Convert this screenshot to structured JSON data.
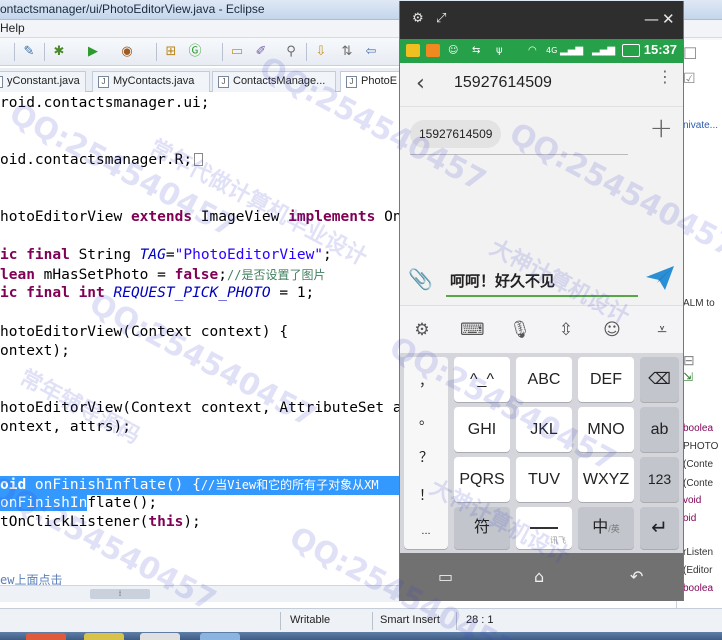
{
  "window": {
    "title": "ontactsmanager/ui/PhotoEditorView.java - Eclipse",
    "menu_first": "Help"
  },
  "editor_tabs": [
    {
      "label": "yConstant.java"
    },
    {
      "label": "MyContacts.java"
    },
    {
      "label": "ContactsManage..."
    },
    {
      "label": "PhotoE"
    }
  ],
  "code": [
    {
      "plain": "roid.contactsmanager.ui;"
    },
    {
      "plain": "oid.contactsmanager.R;"
    },
    {
      "p1": "hotoEditorView ",
      "k1": "extends",
      "p2": " ImageView ",
      "k2": "implements",
      "p3": " OnC"
    },
    {
      "k1": "ic final",
      "p1": " String ",
      "i1": "TAG",
      "p2": "=",
      "s1": "\"PhotoEditorView\"",
      "p3": ";"
    },
    {
      "k1": "lean",
      "p1": " mHasSetPhoto = ",
      "k2": "false",
      "p2": ";",
      "c1": "//是否设置了图片"
    },
    {
      "k1": "ic final int",
      "p1": " ",
      "i1": "REQUEST_PICK_PHOTO",
      "p2": " = 1;"
    },
    {
      "plain": "hotoEditorView(Context context) {"
    },
    {
      "plain": "ontext);"
    },
    {
      "plain": "hotoEditorView(Context context, AttributeSet attr"
    },
    {
      "plain": "ontext, attrs);"
    },
    {
      "k1": "oid",
      "p1": " onFinishInflate() {",
      "c1": "//当View和它的所有子对象从XM"
    },
    {
      "s_part": "onFinishIn",
      "p1": "flate();"
    },
    {
      "p1": "tOnClickListener(",
      "k1": "this",
      "p2": ");"
    },
    {
      "c1": "ew上面点击"
    }
  ],
  "status": {
    "writable": "Writable",
    "insert_mode": "Smart Insert",
    "position": "28 : 1"
  },
  "right_panel": [
    "nivate...",
    "ALM to",
    "boolea",
    "PHOTO",
    "(Conte",
    "(Conte",
    "void",
    "oid",
    "rListen",
    "(Editor",
    "boolea"
  ],
  "phone": {
    "clock": "15:37",
    "network": "4G",
    "contact_number": "15927614509",
    "recipient_chip": "15927614509",
    "message_text": "呵呵！好久不见",
    "keyboard": {
      "left_column": [
        "，",
        "。",
        "？",
        "！",
        "..."
      ],
      "rows": [
        [
          "^_^",
          "ABC",
          "DEF"
        ],
        [
          "GHI",
          "JKL",
          "MNO"
        ],
        [
          "PQRS",
          "TUV",
          "WXYZ"
        ]
      ],
      "right_keys": [
        "ab",
        "123"
      ],
      "backspace": "⌫",
      "symbol_key": "符",
      "space_sub": "讯飞",
      "lang_key": "中",
      "lang_sub": "/英",
      "enter": "↵"
    }
  },
  "watermark": {
    "qq": "QQ:254540457",
    "text1": "常年代做计算机毕业设计",
    "text2": "大神计算机设计",
    "text3": "常年辅导源码"
  }
}
